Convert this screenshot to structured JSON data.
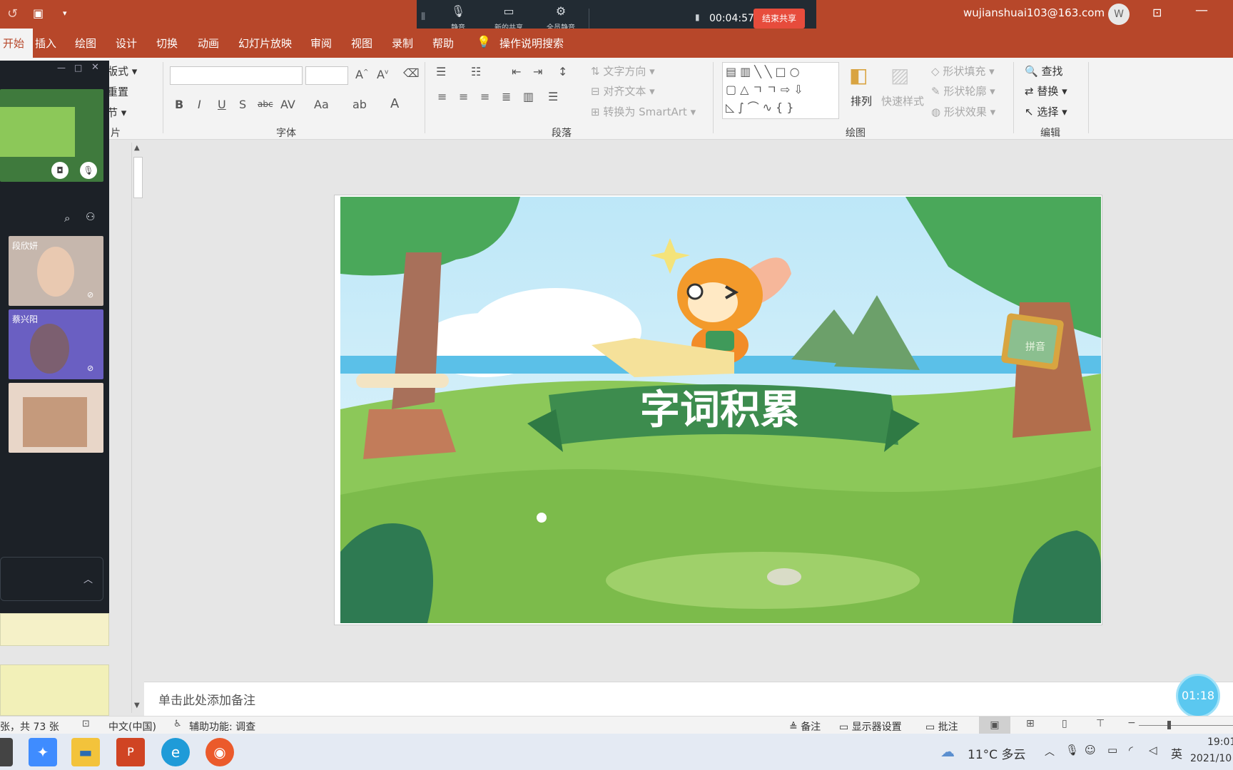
{
  "titlebar": {
    "user_email": "wujianshuai103@163.com",
    "avatar_letter": "W"
  },
  "share_toolbar": {
    "mute_label": "静音",
    "new_share_label": "新的共享",
    "mute_all_label": "全员静音",
    "elapsed": "00:04:57",
    "end_share_label": "结束共享"
  },
  "ribbon_tabs": [
    {
      "label": "开始",
      "active": true
    },
    {
      "label": "插入"
    },
    {
      "label": "绘图"
    },
    {
      "label": "设计"
    },
    {
      "label": "切换"
    },
    {
      "label": "动画"
    },
    {
      "label": "幻灯片放映"
    },
    {
      "label": "审阅"
    },
    {
      "label": "视图"
    },
    {
      "label": "录制"
    },
    {
      "label": "帮助"
    },
    {
      "label": "操作说明搜索"
    }
  ],
  "ribbon": {
    "slides_group": {
      "layout": "版式",
      "reset": "重置",
      "section": "节",
      "label": "片"
    },
    "font_group": {
      "label": "字体"
    },
    "paragraph_group": {
      "label": "段落",
      "text_direction": "文字方向",
      "align_text": "对齐文本",
      "smartart": "转换为 SmartArt"
    },
    "drawing_group": {
      "label": "绘图",
      "arrange": "排列",
      "quick_styles": "快速样式",
      "shape_fill": "形状填充",
      "shape_outline": "形状轮廓",
      "shape_effects": "形状效果"
    },
    "editing_group": {
      "label": "编辑",
      "find": "查找",
      "replace": "替换",
      "select": "选择"
    }
  },
  "meeting_panel": {
    "participants": [
      {
        "name": "段欣妍"
      },
      {
        "name": "蔡兴阳"
      },
      {
        "name": ""
      }
    ]
  },
  "slide": {
    "banner_text": "字词积累",
    "board_text": "拼音"
  },
  "notes": {
    "placeholder": "单击此处添加备注"
  },
  "statusbar": {
    "slide_count": "张，共 73 张",
    "language": "中文(中国)",
    "accessibility": "辅助功能: 调查",
    "notes_btn": "备注",
    "display_settings": "显示器设置",
    "comments": "批注"
  },
  "timer_badge": "01:18",
  "taskbar": {
    "weather": "11°C  多云",
    "ime": "英",
    "time": "19:01",
    "date": "2021/10"
  },
  "colors": {
    "accent": "#b7472a",
    "end_share": "#e74c3c",
    "timer": "#5bc8f0"
  }
}
